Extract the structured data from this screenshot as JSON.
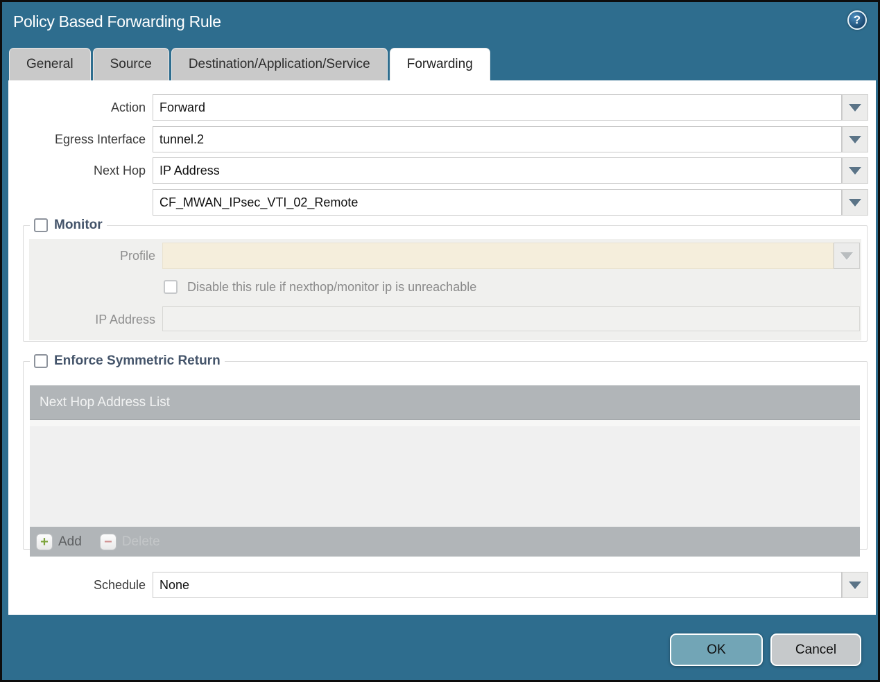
{
  "window": {
    "title": "Policy Based Forwarding Rule"
  },
  "tabs": [
    {
      "label": "General",
      "active": false
    },
    {
      "label": "Source",
      "active": false
    },
    {
      "label": "Destination/Application/Service",
      "active": false
    },
    {
      "label": "Forwarding",
      "active": true
    }
  ],
  "form": {
    "action": {
      "label": "Action",
      "value": "Forward"
    },
    "egress_interface": {
      "label": "Egress Interface",
      "value": "tunnel.2"
    },
    "next_hop": {
      "label": "Next Hop",
      "value": "IP Address"
    },
    "next_hop_address": {
      "value": "CF_MWAN_IPsec_VTI_02_Remote"
    },
    "schedule": {
      "label": "Schedule",
      "value": "None"
    }
  },
  "monitor": {
    "legend": "Monitor",
    "checked": false,
    "profile": {
      "label": "Profile",
      "value": ""
    },
    "disable_rule": {
      "label": "Disable this rule if nexthop/monitor ip is unreachable",
      "checked": false
    },
    "ip_address": {
      "label": "IP Address",
      "value": ""
    }
  },
  "symmetric_return": {
    "legend": "Enforce Symmetric Return",
    "checked": false,
    "table": {
      "header": "Next Hop Address List",
      "rows": []
    },
    "add_label": "Add",
    "delete_label": "Delete",
    "delete_enabled": false
  },
  "footer": {
    "ok_label": "OK",
    "cancel_label": "Cancel"
  },
  "icons": {
    "help": "?",
    "add_plus": "+",
    "delete_minus": "−"
  },
  "colors": {
    "chrome_teal": "#2e6d8e",
    "active_tab": "#ffffff",
    "inactive_tab": "#c9c9c9",
    "table_bar": "#b1b5b8",
    "disabled_section": "#f0f0ee",
    "disabled_field_beige": "#f5eedc",
    "ok_button": "#72a5b6",
    "cancel_button": "#c6c9cb",
    "legend_text": "#44546a"
  }
}
